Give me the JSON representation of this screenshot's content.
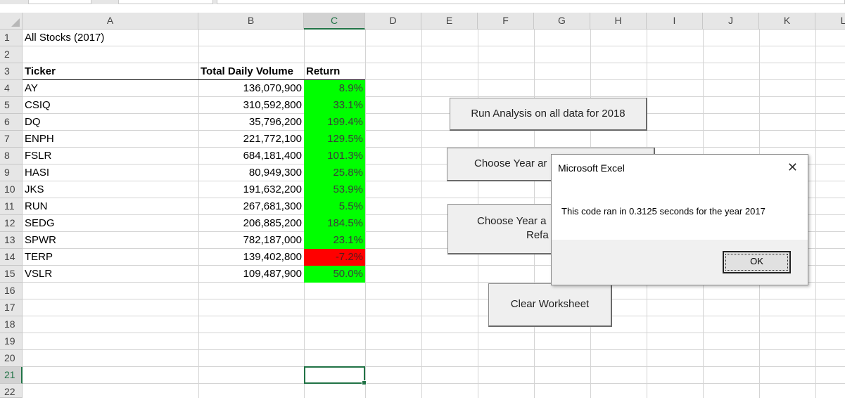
{
  "columns": [
    "A",
    "B",
    "C",
    "D",
    "E",
    "F",
    "G",
    "H",
    "I",
    "J",
    "K",
    "L"
  ],
  "rows": [
    "1",
    "2",
    "3",
    "4",
    "5",
    "6",
    "7",
    "8",
    "9",
    "10",
    "11",
    "12",
    "13",
    "14",
    "15",
    "16",
    "17",
    "18",
    "19",
    "20",
    "21",
    "22"
  ],
  "sheet": {
    "title": "All Stocks (2017)",
    "headers": {
      "ticker": "Ticker",
      "volume": "Total Daily Volume",
      "return": "Return"
    },
    "data": [
      {
        "ticker": "AY",
        "volume": "136,070,900",
        "return": "8.9%",
        "status": "positive"
      },
      {
        "ticker": "CSIQ",
        "volume": "310,592,800",
        "return": "33.1%",
        "status": "positive"
      },
      {
        "ticker": "DQ",
        "volume": "35,796,200",
        "return": "199.4%",
        "status": "positive"
      },
      {
        "ticker": "ENPH",
        "volume": "221,772,100",
        "return": "129.5%",
        "status": "positive"
      },
      {
        "ticker": "FSLR",
        "volume": "684,181,400",
        "return": "101.3%",
        "status": "positive"
      },
      {
        "ticker": "HASI",
        "volume": "80,949,300",
        "return": "25.8%",
        "status": "positive"
      },
      {
        "ticker": "JKS",
        "volume": "191,632,200",
        "return": "53.9%",
        "status": "positive"
      },
      {
        "ticker": "RUN",
        "volume": "267,681,300",
        "return": "5.5%",
        "status": "positive"
      },
      {
        "ticker": "SEDG",
        "volume": "206,885,200",
        "return": "184.5%",
        "status": "positive"
      },
      {
        "ticker": "SPWR",
        "volume": "782,187,000",
        "return": "23.1%",
        "status": "positive"
      },
      {
        "ticker": "TERP",
        "volume": "139,402,800",
        "return": "-7.2%",
        "status": "negative"
      },
      {
        "ticker": "VSLR",
        "volume": "109,487,900",
        "return": "50.0%",
        "status": "positive"
      }
    ]
  },
  "buttons": {
    "run_all": "Run Analysis on all data for 2018",
    "choose_year": "Choose Year ar",
    "choose_year_refactored_line1": "Choose Year a",
    "choose_year_refactored_line2": "Refa",
    "clear": "Clear Worksheet"
  },
  "dialog": {
    "title": "Microsoft Excel",
    "message": "This code ran in 0.3125 seconds for the year 2017",
    "ok_label": "OK",
    "close_glyph": "✕"
  },
  "colors": {
    "positive": "#00ff00",
    "negative": "#ff0000",
    "selection": "#217346"
  }
}
